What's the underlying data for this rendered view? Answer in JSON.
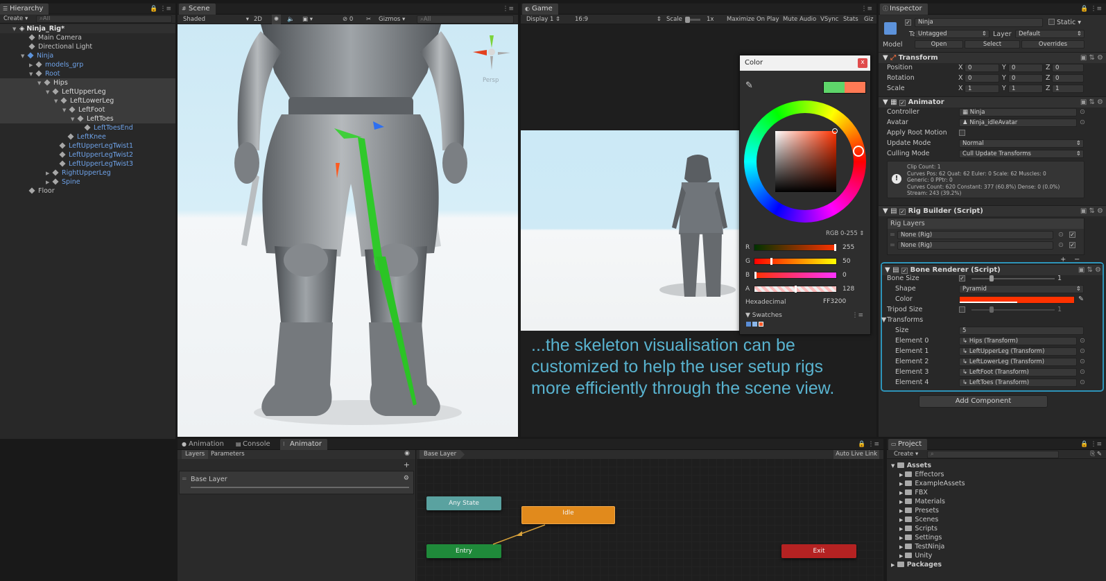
{
  "hierarchy": {
    "tab": "Hierarchy",
    "create": "Create",
    "search": "All",
    "root": "Ninja_Rig*",
    "items": [
      "Main Camera",
      "Directional Light",
      "Ninja",
      "models_grp",
      "Root",
      "Hips",
      "LeftUpperLeg",
      "LeftLowerLeg",
      "LeftFoot",
      "LeftToes",
      "LeftToesEnd",
      "LeftKnee",
      "LeftUpperLegTwist1",
      "LeftUpperLegTwist2",
      "LeftUpperLegTwist3",
      "RightUpperLeg",
      "Spine",
      "Floor"
    ]
  },
  "scene": {
    "tab": "Scene",
    "shading": "Shaded",
    "mode2d": "2D",
    "gizmo_count": "0",
    "gizmos": "Gizmos",
    "search": "All",
    "persp": "Persp"
  },
  "game": {
    "tab": "Game",
    "display": "Display 1",
    "aspect": "16:9",
    "scale_label": "Scale",
    "scale_value": "1x",
    "buttons": [
      "Maximize On Play",
      "Mute Audio",
      "VSync",
      "Stats",
      "Giz"
    ]
  },
  "caption": {
    "line1": "...the skeleton visualisation can be",
    "line2": "customized to help the user setup rigs",
    "line3": "more efficiently through the scene view."
  },
  "color_picker": {
    "title": "Color",
    "close": "x",
    "mode": "RGB 0-255",
    "channels": [
      {
        "label": "R",
        "value": "255",
        "level": 1.0
      },
      {
        "label": "G",
        "value": "50",
        "level": 0.196
      },
      {
        "label": "B",
        "value": "0",
        "level": 0.0
      },
      {
        "label": "A",
        "value": "128",
        "level": 0.502
      }
    ],
    "hex_label": "Hexadecimal",
    "hex_value": "FF3200",
    "swatches_label": "Swatches",
    "color": "#ff3200"
  },
  "inspector": {
    "tab": "Inspector",
    "object_name": "Ninja",
    "static_label": "Static",
    "tag_label": "Tag",
    "tag_value": "Untagged",
    "layer_label": "Layer",
    "layer_value": "Default",
    "model_label": "Model",
    "model_buttons": [
      "Open",
      "Select",
      "Overrides"
    ],
    "transform": {
      "title": "Transform",
      "rows": [
        {
          "label": "Position",
          "x": "0",
          "y": "0",
          "z": "0"
        },
        {
          "label": "Rotation",
          "x": "0",
          "y": "0",
          "z": "0"
        },
        {
          "label": "Scale",
          "x": "1",
          "y": "1",
          "z": "1"
        }
      ]
    },
    "animator": {
      "title": "Animator",
      "controller_label": "Controller",
      "controller_value": "Ninja",
      "avatar_label": "Avatar",
      "avatar_value": "Ninja_idleAvatar",
      "root_motion_label": "Apply Root Motion",
      "update_mode_label": "Update Mode",
      "update_mode_value": "Normal",
      "culling_label": "Culling Mode",
      "culling_value": "Cull Update Transforms",
      "info": [
        "Clip Count: 1",
        "Curves Pos: 62 Quat: 62 Euler: 0 Scale: 62 Muscles: 0",
        "Generic: 0 PPtr: 0",
        "Curves Count: 620 Constant: 377 (60.8%) Dense: 0 (0.0%)",
        "Stream: 243 (39.2%)"
      ]
    },
    "rig_builder": {
      "title": "Rig Builder (Script)",
      "layers_label": "Rig Layers",
      "layers": [
        "None (Rig)",
        "None (Rig)"
      ]
    },
    "bone_renderer": {
      "title": "Bone Renderer (Script)",
      "bone_size_label": "Bone Size",
      "bone_size_value": "1",
      "shape_label": "Shape",
      "shape_value": "Pyramid",
      "color_label": "Color",
      "tripod_label": "Tripod Size",
      "tripod_value": "1",
      "transforms_label": "Transforms",
      "size_label": "Size",
      "size_value": "5",
      "elements": [
        {
          "label": "Element 0",
          "value": "Hips (Transform)"
        },
        {
          "label": "Element 1",
          "value": "LeftUpperLeg (Transform)"
        },
        {
          "label": "Element 2",
          "value": "LeftLowerLeg (Transform)"
        },
        {
          "label": "Element 3",
          "value": "LeftFoot (Transform)"
        },
        {
          "label": "Element 4",
          "value": "LeftToes (Transform)"
        }
      ]
    },
    "add_component": "Add Component"
  },
  "animator_window": {
    "tabs": [
      "Animation",
      "Console",
      "Animator"
    ],
    "sub_tabs": [
      "Layers",
      "Parameters"
    ],
    "breadcrumb": "Base Layer",
    "auto_live": "Auto Live Link",
    "layer_name": "Base Layer",
    "nodes": {
      "any": "Any State",
      "idle": "Idle",
      "entry": "Entry",
      "exit": "Exit"
    }
  },
  "project": {
    "tab": "Project",
    "create": "Create",
    "assets": "Assets",
    "folders": [
      "Effectors",
      "ExampleAssets",
      "FBX",
      "Materials",
      "Presets",
      "Scenes",
      "Scripts",
      "Settings",
      "TestNinja",
      "Unity"
    ],
    "packages": "Packages"
  }
}
